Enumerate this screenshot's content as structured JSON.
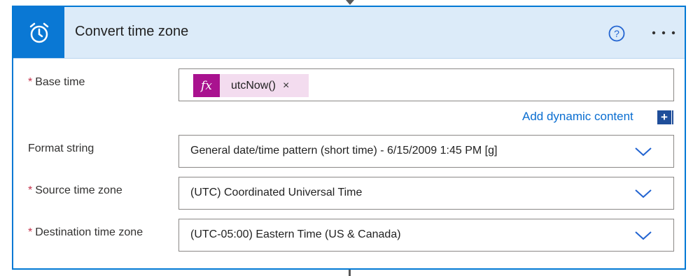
{
  "action": {
    "title": "Convert time zone",
    "icon": "alarm-clock-icon"
  },
  "fields": {
    "base_time": {
      "required_mark": "*",
      "label": "Base time",
      "token_icon": "fx",
      "token_text": "utcNow()",
      "token_remove": "×"
    },
    "dynamic_content_label": "Add dynamic content",
    "dynamic_content_icon": "+",
    "format_string": {
      "label": "Format string",
      "value": "General date/time pattern (short time) - 6/15/2009 1:45 PM [g]"
    },
    "source_time_zone": {
      "required_mark": "*",
      "label": "Source time zone",
      "value": "(UTC) Coordinated Universal Time"
    },
    "destination_time_zone": {
      "required_mark": "*",
      "label": "Destination time zone",
      "value": "(UTC-05:00) Eastern Time (US & Canada)"
    }
  },
  "colors": {
    "accent": "#0078d4",
    "header_bg": "#dcebf9",
    "token_bg": "#f3dcef",
    "token_icon_bg": "#a9128f",
    "required": "#c4314b"
  }
}
